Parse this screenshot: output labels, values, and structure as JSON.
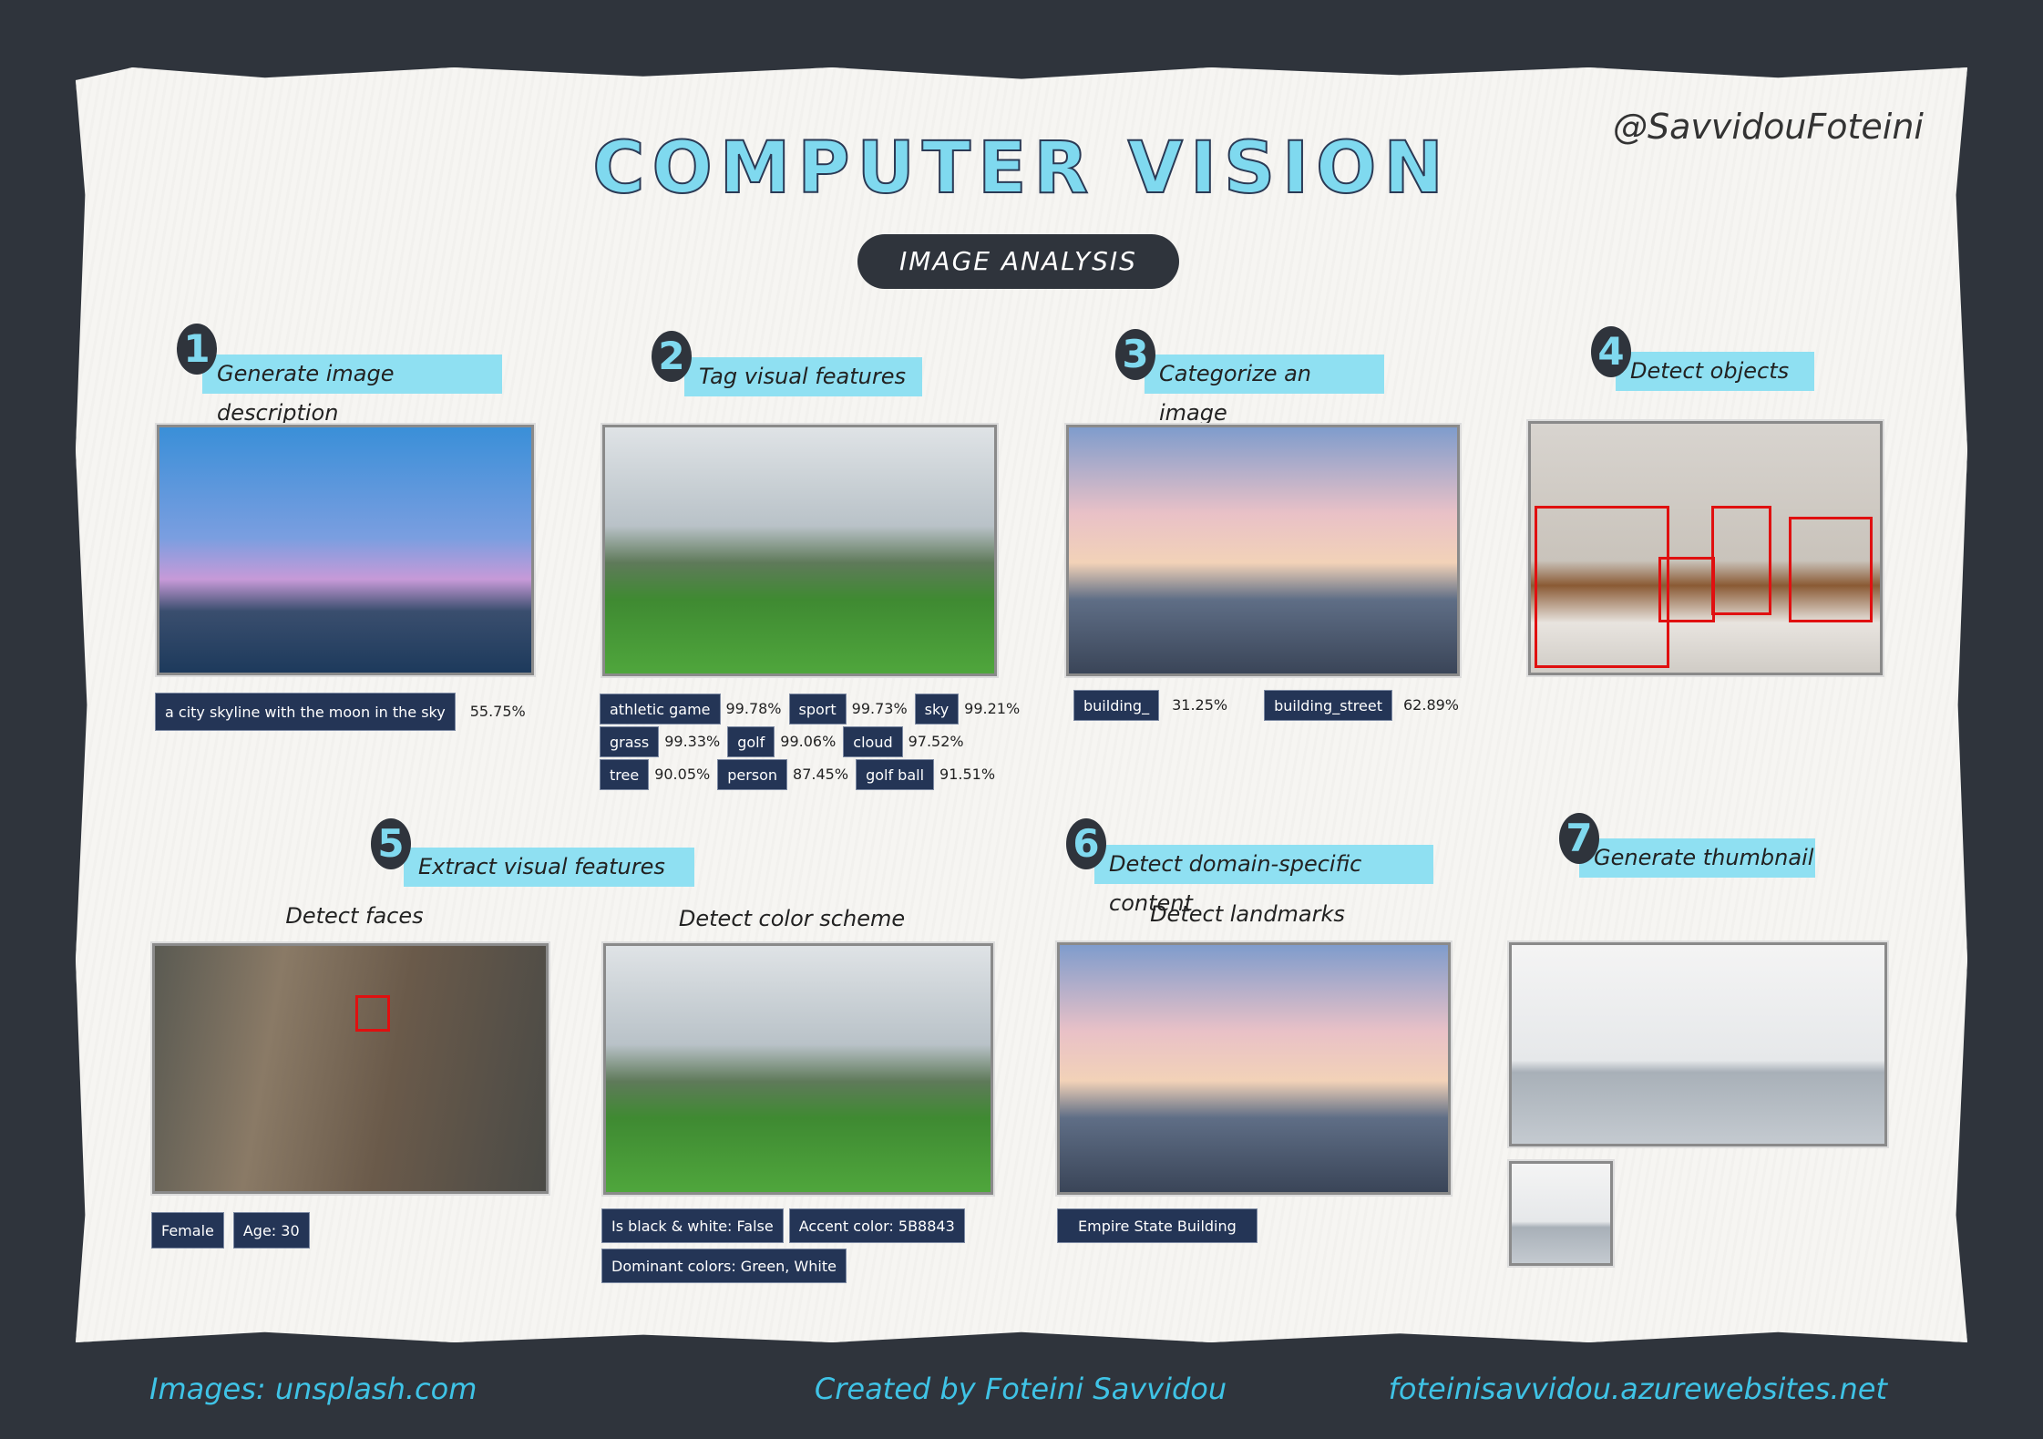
{
  "title": "COMPUTER VISION",
  "subtitle": "IMAGE ANALYSIS",
  "handle": "@SavvidouFoteini",
  "sections": [
    {
      "num": "1",
      "label": "Generate image description"
    },
    {
      "num": "2",
      "label": "Tag visual features"
    },
    {
      "num": "3",
      "label": "Categorize an image"
    },
    {
      "num": "4",
      "label": "Detect objects"
    },
    {
      "num": "5",
      "label": "Extract visual features"
    },
    {
      "num": "6",
      "label": "Detect domain-specific content"
    },
    {
      "num": "7",
      "label": "Generate thumbnail"
    }
  ],
  "description": {
    "text": "a city skyline with the moon in the sky",
    "confidence": "55.75%"
  },
  "tags": [
    {
      "name": "athletic game",
      "conf": "99.78%"
    },
    {
      "name": "sport",
      "conf": "99.73%"
    },
    {
      "name": "sky",
      "conf": "99.21%"
    },
    {
      "name": "grass",
      "conf": "99.33%"
    },
    {
      "name": "golf",
      "conf": "99.06%"
    },
    {
      "name": "cloud",
      "conf": "97.52%"
    },
    {
      "name": "tree",
      "conf": "90.05%"
    },
    {
      "name": "person",
      "conf": "87.45%"
    },
    {
      "name": "golf ball",
      "conf": "91.51%"
    }
  ],
  "categories": [
    {
      "name": "building_",
      "conf": "31.25%"
    },
    {
      "name": "building_street",
      "conf": "62.89%"
    }
  ],
  "faces": {
    "title": "Detect faces",
    "gender": "Female",
    "age": "Age: 30"
  },
  "color": {
    "title": "Detect color scheme",
    "bw": "Is black & white: False",
    "accent": "Accent color: 5B8843",
    "dominant": "Dominant colors: Green, White"
  },
  "landmarks": {
    "title": "Detect landmarks",
    "name": "Empire State Building"
  },
  "colors": {
    "accent_cyan": "#8fe0f2",
    "tag_bg": "#243556",
    "box": "#e01010",
    "background": "#2f343c"
  },
  "footer": {
    "images": "Images: unsplash.com",
    "created": "Created by Foteini Savvidou",
    "url": "foteinisavvidou.azurewebsites.net"
  }
}
